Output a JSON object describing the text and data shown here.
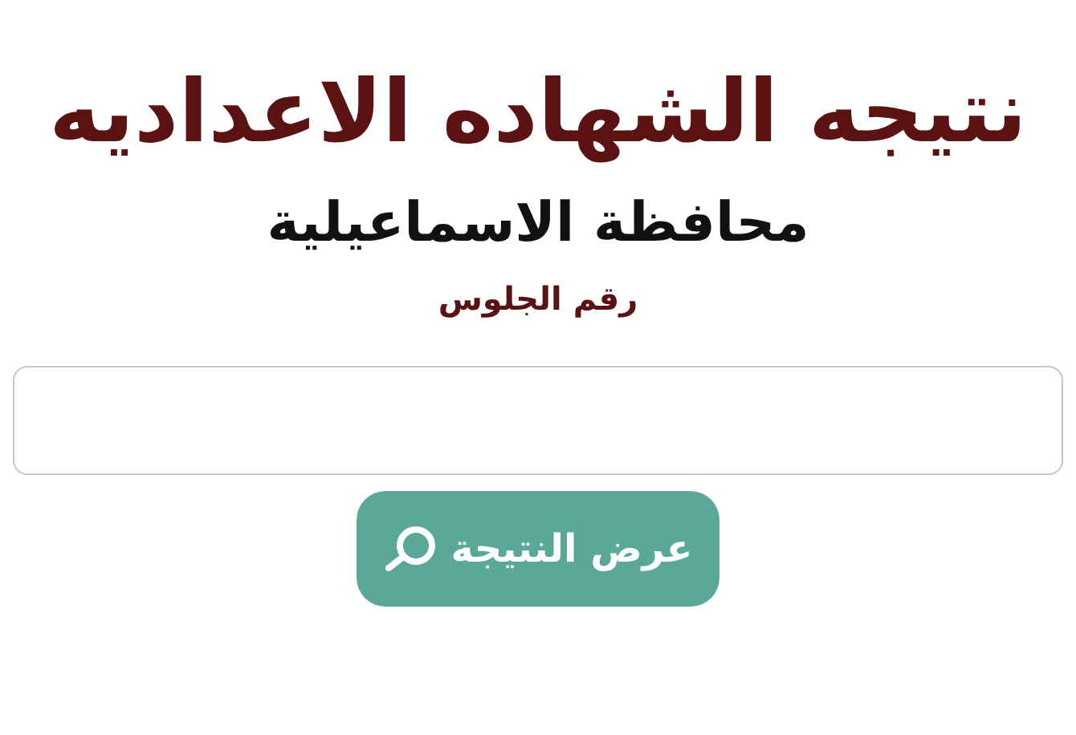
{
  "title": "نتيجه الشهاده الاعداديه",
  "subtitle": "محافظة الاسماعيلية",
  "seat_number": {
    "label": "رقم الجلوس"
  },
  "button": {
    "label": "عرض النتيجة"
  }
}
